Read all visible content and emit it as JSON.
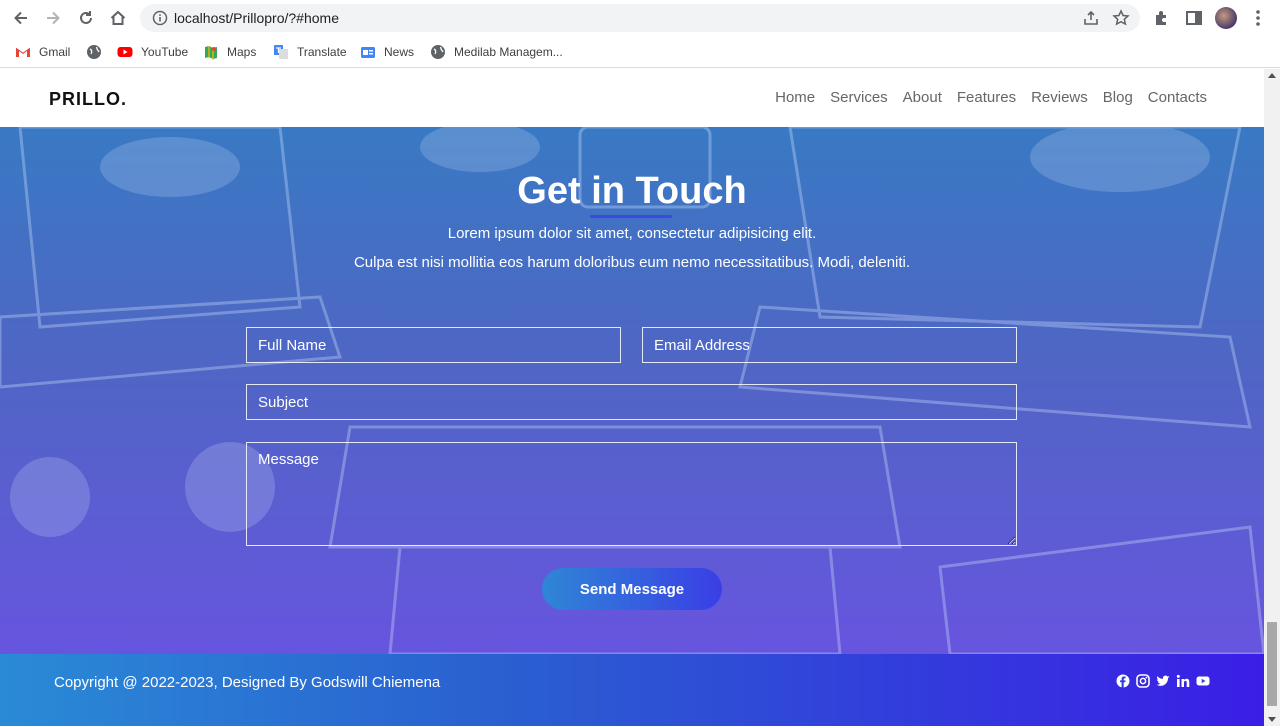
{
  "browser": {
    "url": "localhost/Prillopro/?#home",
    "bookmarks": [
      "Gmail",
      "",
      "YouTube",
      "Maps",
      "Translate",
      "News",
      "Medilab Managem..."
    ]
  },
  "site": {
    "logo": "PRILLO.",
    "nav": [
      "Home",
      "Services",
      "About",
      "Features",
      "Reviews",
      "Blog",
      "Contacts"
    ]
  },
  "contact": {
    "title": "Get in Touch",
    "subtitle_line1": "Lorem ipsum dolor sit amet, consectetur adipisicing elit.",
    "subtitle_line2": "Culpa est nisi mollitia eos harum doloribus eum nemo necessitatibus. Modi, deleniti.",
    "full_name_placeholder": "Full Name",
    "email_placeholder": "Email Address",
    "subject_placeholder": "Subject",
    "message_placeholder": "Message",
    "send_label": "Send Message"
  },
  "footer": {
    "copyright": "Copyright @ 2022-2023, Designed By Godswill Chiemena",
    "socials": [
      "facebook-icon",
      "instagram-icon",
      "twitter-icon",
      "linkedin-icon",
      "youtube-icon"
    ]
  },
  "colors": {
    "accent": "#3b4bd8",
    "footer_start": "#2a8ad6",
    "footer_end": "#3a1ee6"
  }
}
